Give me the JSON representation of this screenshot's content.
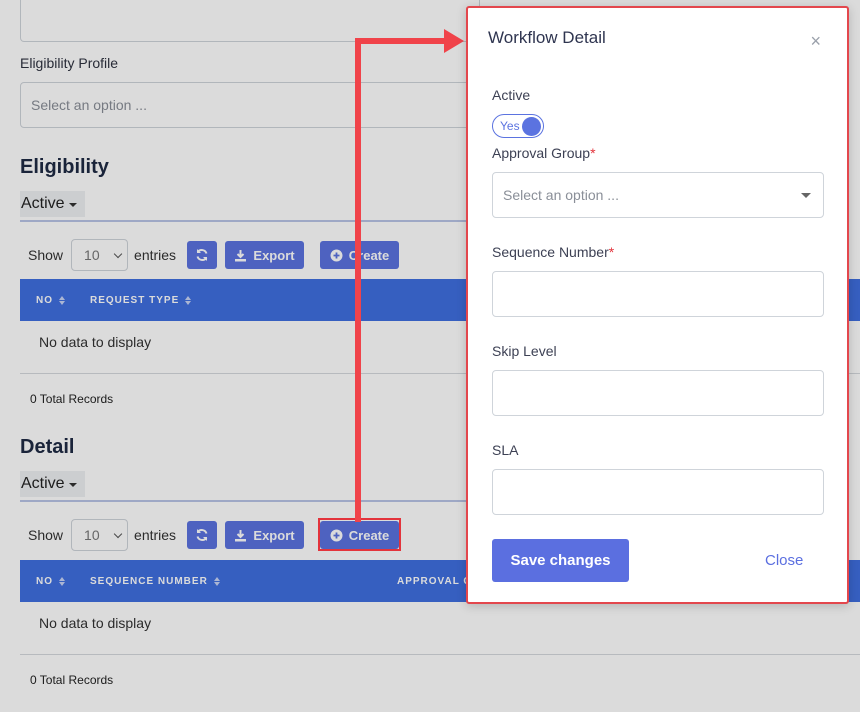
{
  "form": {
    "eligibility_profile_label": "Eligibility Profile",
    "eligibility_profile_placeholder": "Select an option ..."
  },
  "eligibility": {
    "title": "Eligibility",
    "active_label": "Active",
    "show_label": "Show",
    "entries_value": "10",
    "entries_label": "entries",
    "export_label": "Export",
    "create_label": "Create",
    "columns": [
      "NO",
      "REQUEST TYPE"
    ],
    "empty_text": "No data to display",
    "total_records": "0 Total Records"
  },
  "detail": {
    "title": "Detail",
    "active_label": "Active",
    "show_label": "Show",
    "entries_value": "10",
    "entries_label": "entries",
    "export_label": "Export",
    "create_label": "Create",
    "columns": [
      "NO",
      "SEQUENCE NUMBER",
      "APPROVAL G"
    ],
    "empty_text": "No data to display",
    "total_records": "0 Total Records"
  },
  "modal": {
    "title": "Workflow Detail",
    "close_icon": "×",
    "active_label": "Active",
    "active_toggle_text": "Yes",
    "active_value": true,
    "approval_group_label": "Approval Group",
    "approval_group_placeholder": "Select an option ...",
    "sequence_number_label": "Sequence Number",
    "skip_level_label": "Skip Level",
    "sla_label": "SLA",
    "required_mark": "*",
    "save_label": "Save changes",
    "close_label": "Close"
  },
  "colors": {
    "primary": "#5b73e0",
    "table_header": "#3f6fe0",
    "annotation": "#f0434a"
  }
}
